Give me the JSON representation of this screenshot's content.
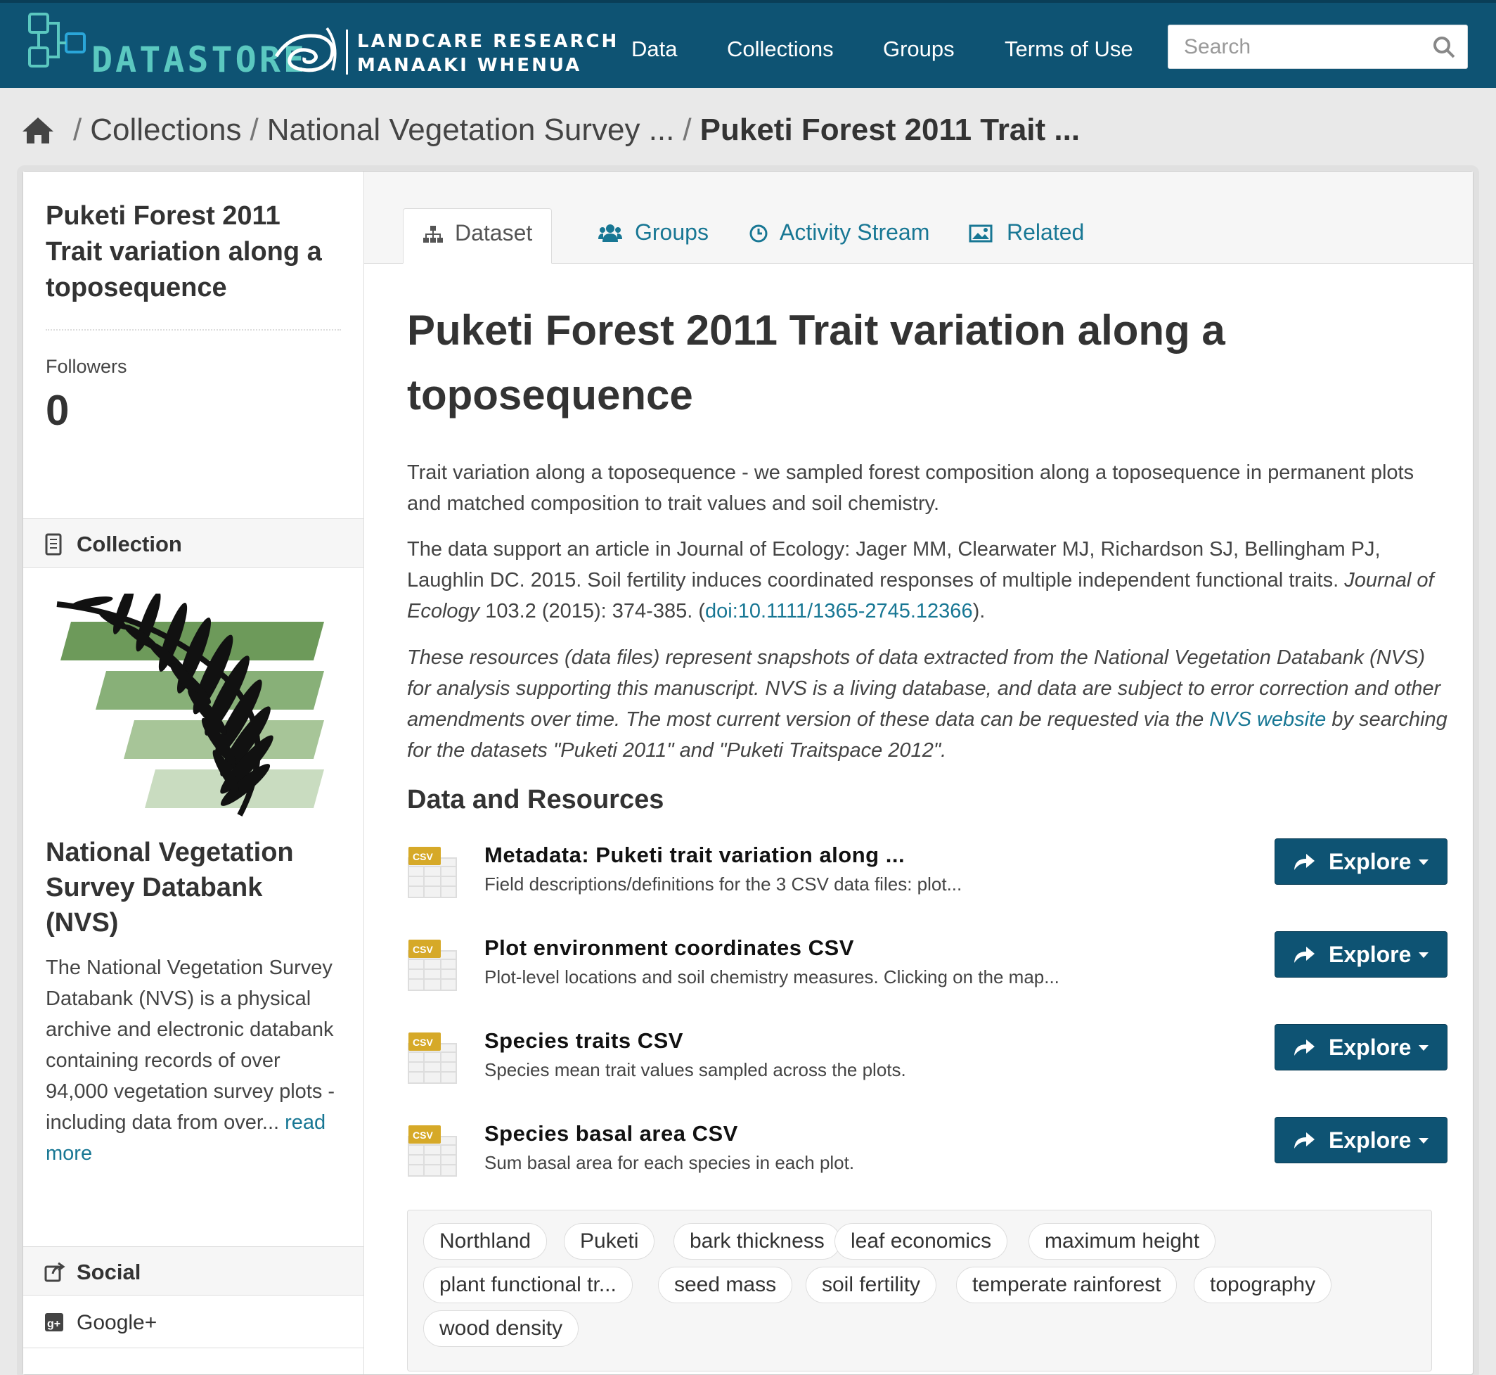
{
  "header": {
    "brand": "DATASTORE",
    "org_line1": "LANDCARE RESEARCH",
    "org_line2": "MANAAKI WHENUA",
    "nav": [
      "Data",
      "Collections",
      "Groups",
      "Terms of Use"
    ],
    "search_placeholder": "Search"
  },
  "breadcrumb": {
    "items": [
      "Collections",
      "National Vegetation Survey ..."
    ],
    "current": "Puketi Forest 2011 Trait ..."
  },
  "sidebar": {
    "title": "Puketi Forest 2011 Trait variation along a toposequence",
    "followers_label": "Followers",
    "followers_count": "0",
    "collection_heading": "Collection",
    "collection_title": "National Vegetation Survey Databank (NVS)",
    "collection_desc": "The National Vegetation Survey Databank (NVS) is a physical archive and electronic databank containing records of over 94,000 vegetation survey plots - including data from over...",
    "read_more": "read more",
    "social_heading": "Social",
    "social_item": "Google+"
  },
  "tabs": [
    "Dataset",
    "Groups",
    "Activity Stream",
    "Related"
  ],
  "dataset": {
    "title": "Puketi Forest 2011 Trait variation along a toposequence",
    "para1": "Trait variation along a toposequence - we sampled forest composition along a toposequence in permanent plots and matched composition to trait values and soil chemistry.",
    "para2_a": "The data support an article in Journal of Ecology: Jager MM, Clearwater MJ, Richardson SJ, Bellingham PJ, Laughlin DC. 2015. Soil fertility induces coordinated responses of multiple independent functional traits. ",
    "para2_journal": "Journal of Ecology",
    "para2_b": " 103.2 (2015): 374-385. (",
    "para2_doi": "doi:10.1111/1365-2745.12366",
    "para2_c": ").",
    "para3_a": "These resources (data files) represent snapshots of data extracted from the National Vegetation Databank (NVS) for analysis supporting this manuscript. NVS is a living database, and data are subject to error correction and other amendments over time. The most current version of these data can be requested via the ",
    "para3_link": "NVS website",
    "para3_b": " by searching for the datasets \"Puketi 2011\" and \"Puketi Traitspace 2012\".",
    "resources_heading": "Data and Resources",
    "resources": [
      {
        "format": "CSV",
        "title": "Metadata: Puketi trait variation along ...",
        "desc": "Field descriptions/definitions for the 3 CSV data files: plot...",
        "button": "Explore"
      },
      {
        "format": "CSV",
        "title": "Plot environment coordinates CSV",
        "desc": "Plot-level locations and soil chemistry measures. Clicking on the map...",
        "button": "Explore"
      },
      {
        "format": "CSV",
        "title": "Species traits CSV",
        "desc": "Species mean trait values sampled across the plots.",
        "button": "Explore"
      },
      {
        "format": "CSV",
        "title": "Species basal area CSV",
        "desc": "Sum basal area for each species in each plot.",
        "button": "Explore"
      }
    ],
    "tags": [
      "Northland",
      "Puketi",
      "bark thickness",
      "leaf economics",
      "maximum height",
      "plant functional tr...",
      "seed mass",
      "soil fertility",
      "temperate rainforest",
      "topography",
      "wood density"
    ]
  },
  "colors": {
    "header_bg": "#0e5373",
    "link": "#187794",
    "button": "#0e5373",
    "brand_teal": "#5bc8c0",
    "brand_blue": "#2aa6d9"
  }
}
